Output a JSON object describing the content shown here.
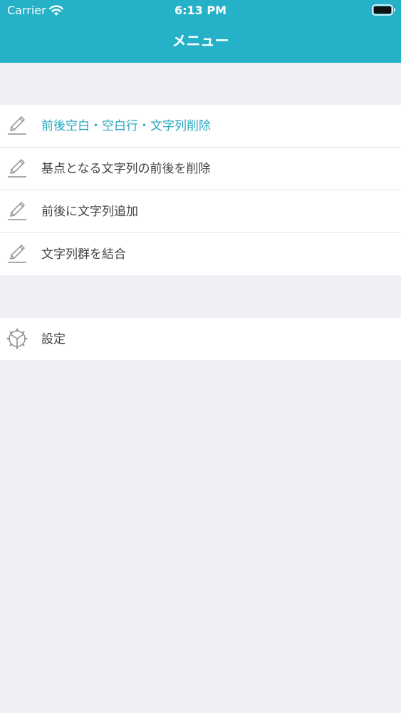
{
  "status_bar": {
    "carrier": "Carrier",
    "time": "6:13 PM",
    "icons": [
      "wifi-icon",
      "battery-icon"
    ]
  },
  "nav": {
    "title": "メニュー"
  },
  "colors": {
    "accent": "#25b1c8",
    "active_text": "#25a7be",
    "text": "#444444",
    "background": "#efeff4"
  },
  "menu": {
    "items": [
      {
        "label": "前後空白・空白行・文字列削除",
        "icon": "pencil-icon",
        "active": true
      },
      {
        "label": "基点となる文字列の前後を削除",
        "icon": "pencil-icon",
        "active": false
      },
      {
        "label": "前後に文字列追加",
        "icon": "pencil-icon",
        "active": false
      },
      {
        "label": "文字列群を結合",
        "icon": "pencil-icon",
        "active": false
      }
    ]
  },
  "settings": {
    "label": "設定",
    "icon": "gear-icon"
  }
}
